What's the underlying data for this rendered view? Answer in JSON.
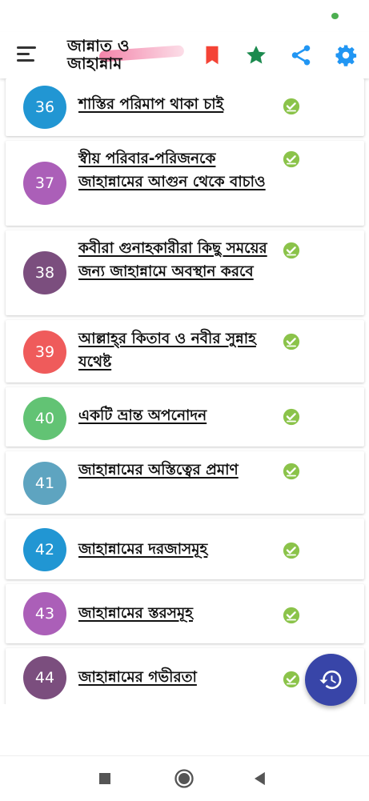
{
  "app": {
    "title_line1": "জান্নাত ও",
    "title_line2": "জাহান্নাম"
  },
  "colors": {
    "bookmark": "#f44336",
    "star": "#1b8a4e",
    "share": "#2196f3",
    "settings": "#2196f3",
    "check": "#8bc34a",
    "fab": "#3845a8"
  },
  "items": [
    {
      "number": "36",
      "title": "শাস্তির পরিমাপ থাকা চাই",
      "color": "#2196d3"
    },
    {
      "number": "37",
      "title": "স্বীয় পরিবার-পরিজনকে জাহান্নামের আগুন থেকে বাচাও",
      "color": "#ab5fb8"
    },
    {
      "number": "38",
      "title": "কবীরা গুনাহকারীরা কিছু সময়ের জন্য জাহান্নামে অবস্থান করবে",
      "color": "#7b4e7e"
    },
    {
      "number": "39",
      "title": "আল্লাহ্‌র কিতাব ও নবীর সুন্নাহ যথেষ্ট",
      "color": "#ef5b5b"
    },
    {
      "number": "40",
      "title": "একটি ভ্রান্ত অপনোদন",
      "color": "#62c374"
    },
    {
      "number": "41",
      "title": "জাহান্নামের অস্তিত্বের প্রমাণ",
      "color": "#5ea4c0"
    },
    {
      "number": "42",
      "title": "জাহান্নামের দরজাসমূহ",
      "color": "#2196d3"
    },
    {
      "number": "43",
      "title": "জাহান্নামের স্তরসমূহ",
      "color": "#ab5fb8"
    },
    {
      "number": "44",
      "title": "জাহান্নামের গভীরতা",
      "color": "#7b4e7e"
    }
  ]
}
